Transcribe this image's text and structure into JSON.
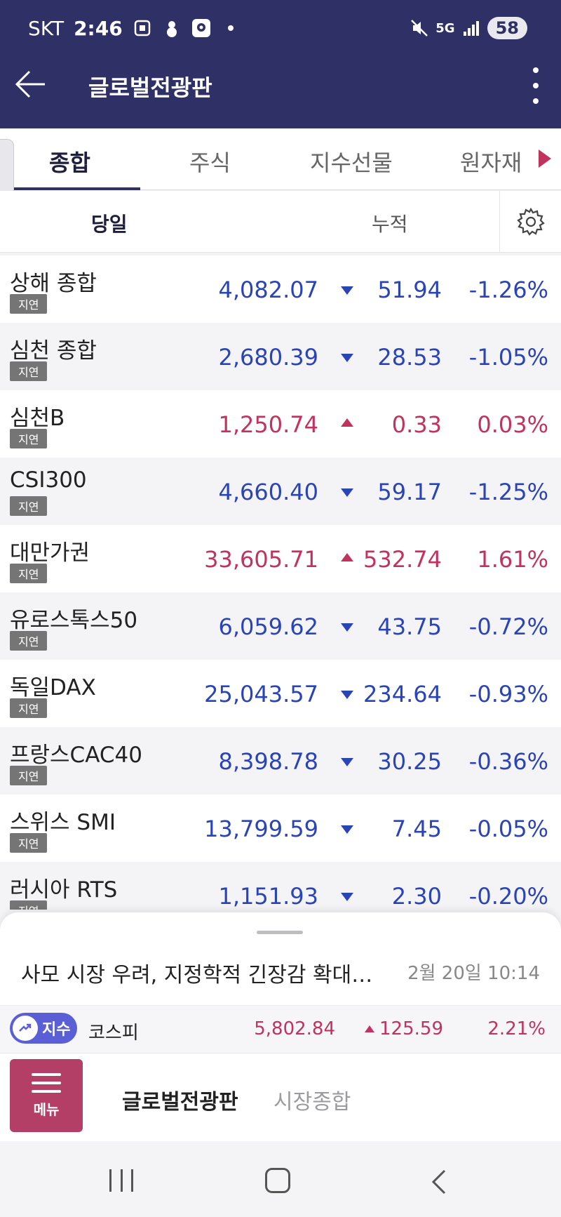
{
  "status_bar": {
    "carrier": "SKT",
    "time": "2:46",
    "network": "5G",
    "battery": "58"
  },
  "header": {
    "title": "글로벌전광판"
  },
  "tabs": [
    {
      "label": "종합",
      "active": true
    },
    {
      "label": "주식",
      "active": false
    },
    {
      "label": "지수선물",
      "active": false
    },
    {
      "label": "원자재",
      "active": false
    }
  ],
  "subtabs": {
    "today": "당일",
    "cumulative": "누적"
  },
  "indices": [
    {
      "name": "상해 종합",
      "badge": "지연",
      "price": "4,082.07",
      "direction": "down",
      "change": "51.94",
      "pct": "-1.26%"
    },
    {
      "name": "심천 종합",
      "badge": "지연",
      "price": "2,680.39",
      "direction": "down",
      "change": "28.53",
      "pct": "-1.05%"
    },
    {
      "name": "심천B",
      "badge": "지연",
      "price": "1,250.74",
      "direction": "up",
      "change": "0.33",
      "pct": "0.03%"
    },
    {
      "name": "CSI300",
      "badge": "지연",
      "price": "4,660.40",
      "direction": "down",
      "change": "59.17",
      "pct": "-1.25%"
    },
    {
      "name": "대만가권",
      "badge": "지연",
      "price": "33,605.71",
      "direction": "up",
      "change": "532.74",
      "pct": "1.61%"
    },
    {
      "name": "유로스톡스50",
      "badge": "지연",
      "price": "6,059.62",
      "direction": "down",
      "change": "43.75",
      "pct": "-0.72%"
    },
    {
      "name": "독일DAX",
      "badge": "지연",
      "price": "25,043.57",
      "direction": "down",
      "change": "234.64",
      "pct": "-0.93%"
    },
    {
      "name": "프랑스CAC40",
      "badge": "지연",
      "price": "8,398.78",
      "direction": "down",
      "change": "30.25",
      "pct": "-0.36%"
    },
    {
      "name": "스위스 SMI",
      "badge": "지연",
      "price": "13,799.59",
      "direction": "down",
      "change": "7.45",
      "pct": "-0.05%"
    },
    {
      "name": "러시아 RTS",
      "badge": "지연",
      "price": "1,151.93",
      "direction": "down",
      "change": "2.30",
      "pct": "-0.20%"
    }
  ],
  "news": {
    "headline": "사모 시장 우려, 지정학적 긴장감 확대…",
    "time": "2월 20일  10:14"
  },
  "ticker": {
    "pill_label": "지수",
    "name": "코스피",
    "value": "5,802.84",
    "change": "125.59",
    "pct": "2.21%"
  },
  "bottom_bar": {
    "menu_label": "메뉴",
    "links": [
      "글로벌전광판",
      "시장종합"
    ]
  },
  "colors": {
    "header_bg": "#2f3066",
    "down": "#2a44b8",
    "up": "#c2325e",
    "menu_bg": "#b43f66"
  }
}
